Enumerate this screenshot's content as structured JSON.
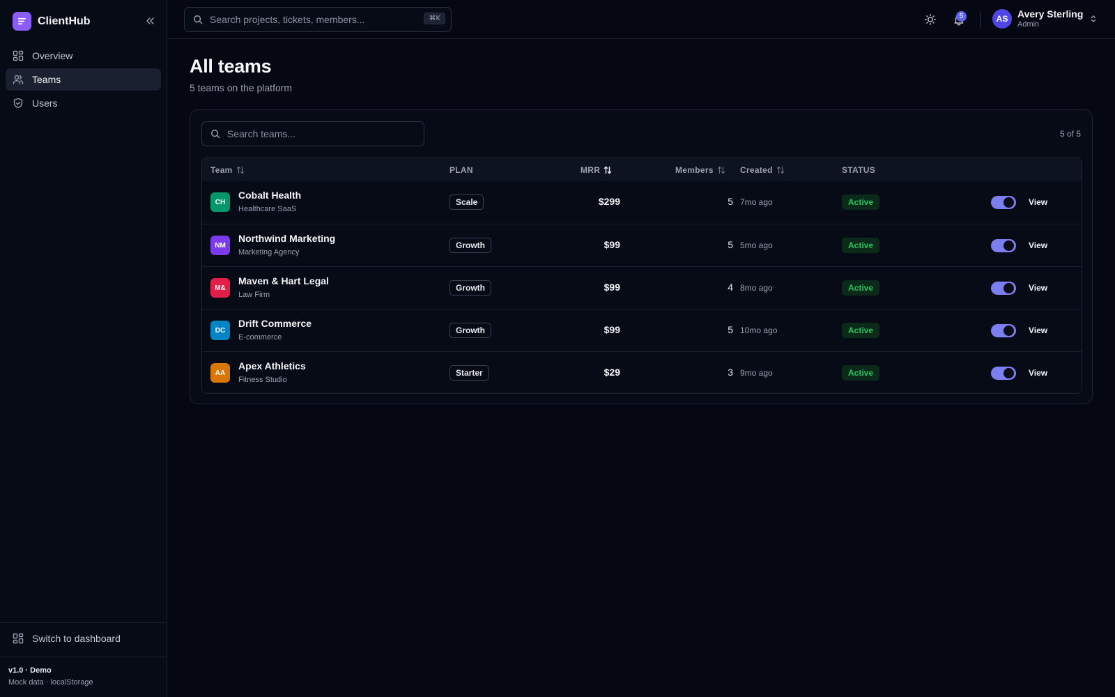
{
  "app": {
    "name": "ClientHub",
    "version": "v1.0 · Demo",
    "version_sub": "Mock data · localStorage",
    "accent": "#8b5cf6"
  },
  "sidebar": {
    "items": [
      {
        "label": "Overview",
        "icon": "grid-icon",
        "active": false
      },
      {
        "label": "Teams",
        "icon": "users-icon",
        "active": true
      },
      {
        "label": "Users",
        "icon": "shield-icon",
        "active": false
      }
    ],
    "switch_label": "Switch to dashboard"
  },
  "topbar": {
    "search_placeholder": "Search projects, tickets, members...",
    "search_shortcut": "⌘K",
    "notification_count": "5",
    "user": {
      "initials": "AS",
      "name": "Avery Sterling",
      "role": "Admin"
    }
  },
  "page": {
    "title": "All teams",
    "subtitle": "5 teams on the platform"
  },
  "teams_panel": {
    "search_placeholder": "Search teams...",
    "count": "5 of 5",
    "columns": {
      "team": "Team",
      "plan": "PLAN",
      "mrr": "MRR",
      "members": "Members",
      "created": "Created",
      "status": "STATUS"
    },
    "rows": [
      {
        "initials": "CH",
        "color": "#059669",
        "name": "Cobalt Health",
        "type": "Healthcare SaaS",
        "plan": "Scale",
        "mrr": "$299",
        "members": "5",
        "created": "7mo ago",
        "status": "Active",
        "enabled": true,
        "action": "View"
      },
      {
        "initials": "NM",
        "color": "#7c3aed",
        "name": "Northwind Marketing",
        "type": "Marketing Agency",
        "plan": "Growth",
        "mrr": "$99",
        "members": "5",
        "created": "5mo ago",
        "status": "Active",
        "enabled": true,
        "action": "View"
      },
      {
        "initials": "M&",
        "color": "#e11d48",
        "name": "Maven & Hart Legal",
        "type": "Law Firm",
        "plan": "Growth",
        "mrr": "$99",
        "members": "4",
        "created": "8mo ago",
        "status": "Active",
        "enabled": true,
        "action": "View"
      },
      {
        "initials": "DC",
        "color": "#0284c7",
        "name": "Drift Commerce",
        "type": "E-commerce",
        "plan": "Growth",
        "mrr": "$99",
        "members": "5",
        "created": "10mo ago",
        "status": "Active",
        "enabled": true,
        "action": "View"
      },
      {
        "initials": "AA",
        "color": "#d97706",
        "name": "Apex Athletics",
        "type": "Fitness Studio",
        "plan": "Starter",
        "mrr": "$29",
        "members": "3",
        "created": "9mo ago",
        "status": "Active",
        "enabled": true,
        "action": "View"
      }
    ]
  }
}
